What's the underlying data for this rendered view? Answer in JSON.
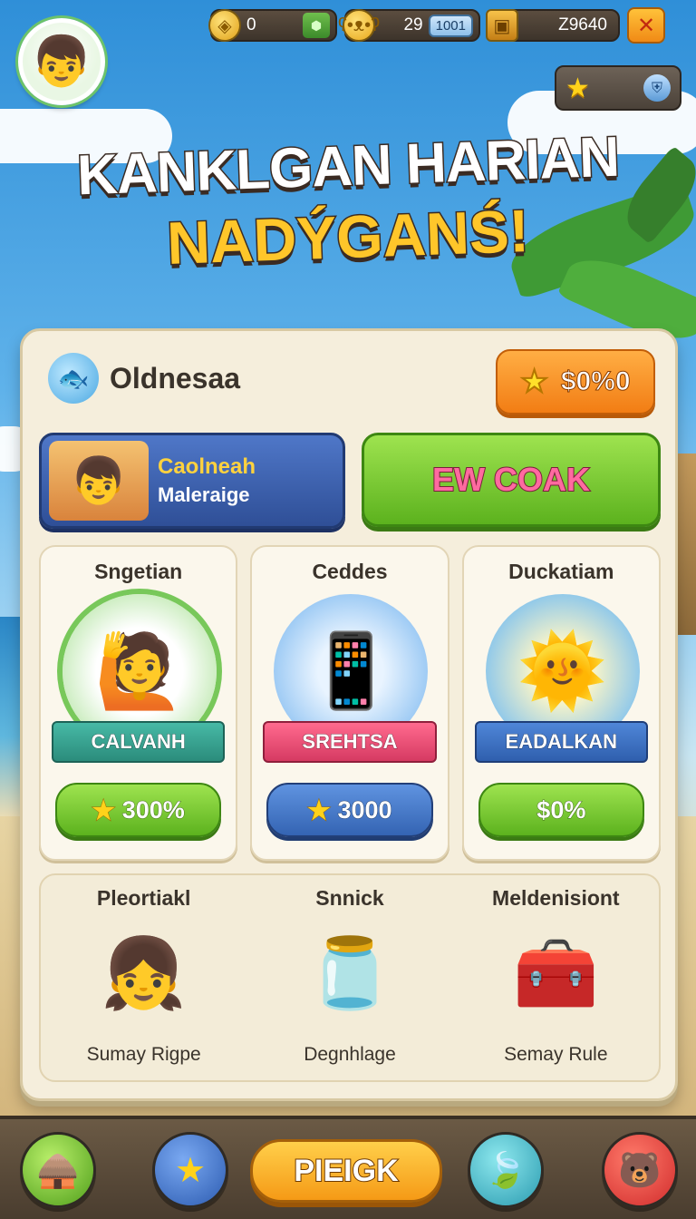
{
  "resources": {
    "coins_value": "0",
    "bear_value": "29",
    "bear_badge": "1001",
    "chest_value": "Z9640"
  },
  "title": {
    "line1": "KANKLGAN HARIAN",
    "line2": "NADÝGANŚ!"
  },
  "panel": {
    "heading": "Oldnesaa",
    "price_label": "$0%0",
    "profile": {
      "name": "Caolneah",
      "subtitle": "Maleraige"
    },
    "action_button": "EW COAK",
    "cards": [
      {
        "title": "Sngetian",
        "ribbon": "CALVANH",
        "button": "300%",
        "has_star": true
      },
      {
        "title": "Ceddes",
        "ribbon": "SREHTSA",
        "button": "3000",
        "has_star": true
      },
      {
        "title": "Duckatiam",
        "ribbon": "EADALKAN",
        "button": "$0%",
        "has_star": false
      }
    ],
    "bottom_items": [
      {
        "title": "Pleortiakl",
        "caption": "Sumay Rigpe"
      },
      {
        "title": "Snnick",
        "caption": "Degnhlage"
      },
      {
        "title": "Meldenisiont",
        "caption": "Semay Rule"
      }
    ]
  },
  "nav": {
    "center_label": "PIEIGK"
  },
  "colors": {
    "accent_orange": "#f27d14",
    "accent_green": "#5cb21e",
    "accent_blue": "#3464b3",
    "panel_bg": "#f5eedc"
  },
  "icons": {
    "avatar": "boy-avatar",
    "star": "star-icon",
    "fish": "fish-icon",
    "hut": "hut-icon",
    "bear": "bear-icon",
    "leaf": "leaf-icon",
    "sun": "sun-character",
    "phone": "phone-icon",
    "jar": "candy-jar-icon",
    "chest": "treasure-chest-icon"
  }
}
